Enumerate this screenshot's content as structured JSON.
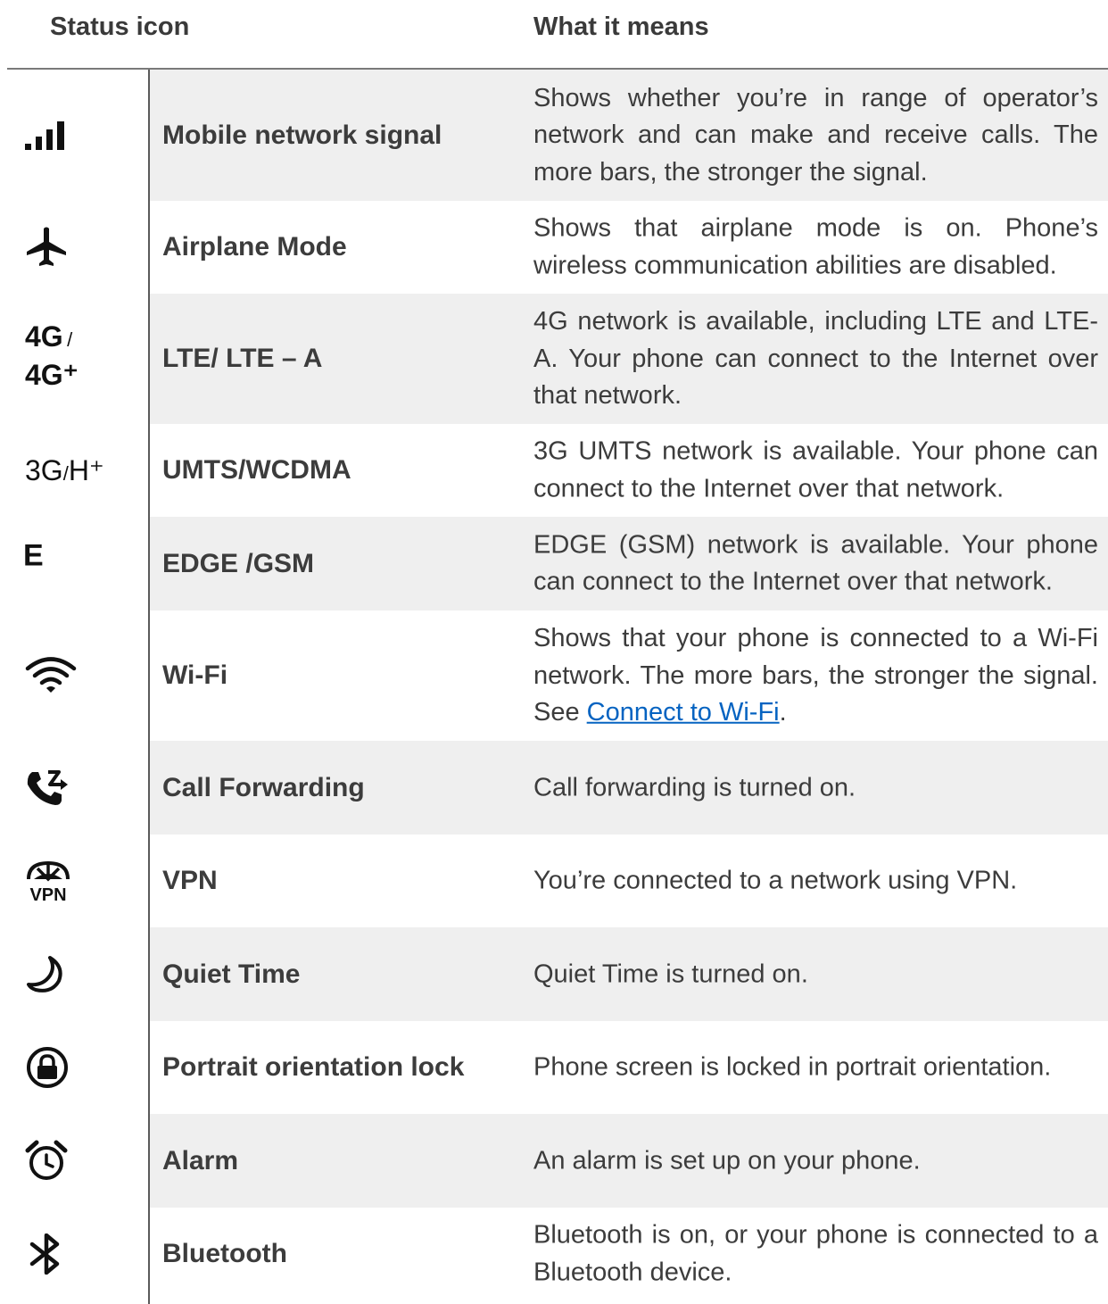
{
  "header": {
    "col1": "Status icon",
    "col2": "What it means"
  },
  "rows": [
    {
      "icon": "mobile-signal-icon",
      "name": "Mobile network signal",
      "desc": "Shows whether you’re in range of operator’s network and can make and receive calls. The more bars, the stronger the signal."
    },
    {
      "icon": "airplane-icon",
      "name": "Airplane Mode",
      "desc": "Shows that airplane mode is on. Phone’s wireless communication abilities are disabled."
    },
    {
      "icon": "4g-icon",
      "icon_text_1": "4G",
      "icon_sep": "/",
      "icon_text_2": "4G⁺",
      "name": "LTE/ LTE – A",
      "desc": "4G network is available, including LTE and LTE-A. Your phone can connect to the Internet over that network."
    },
    {
      "icon": "3g-icon",
      "icon_text_1": "3G",
      "icon_sep": "/",
      "icon_text_2": "H⁺",
      "name": "UMTS/WCDMA",
      "desc": "3G UMTS network is available. Your phone can connect to the Internet over that network."
    },
    {
      "icon": "edge-icon",
      "icon_text_1": "E",
      "name": "EDGE /GSM",
      "desc": "EDGE (GSM) network is available. Your phone can connect to the Internet over that network."
    },
    {
      "icon": "wifi-icon",
      "name": "Wi-Fi",
      "desc_pre": "Shows that your phone is connected to a Wi-Fi network. The more bars, the stronger the signal. See ",
      "desc_link": "Connect to Wi-Fi",
      "desc_post": "."
    },
    {
      "icon": "call-forwarding-icon",
      "name": "Call Forwarding",
      "desc": "Call forwarding is turned on."
    },
    {
      "icon": "vpn-icon",
      "icon_text_1": "VPN",
      "name": "VPN",
      "desc": "You’re connected to a network using VPN."
    },
    {
      "icon": "moon-icon",
      "name": "Quiet Time",
      "desc": "Quiet Time is turned on."
    },
    {
      "icon": "portrait-lock-icon",
      "name": "Portrait orientation lock",
      "desc": "Phone screen is locked in portrait orientation."
    },
    {
      "icon": "alarm-icon",
      "name": "Alarm",
      "desc": "An alarm is set up on your phone."
    },
    {
      "icon": "bluetooth-icon",
      "name": "Bluetooth",
      "desc": "Bluetooth is on, or your phone is connected to a Bluetooth device."
    }
  ]
}
